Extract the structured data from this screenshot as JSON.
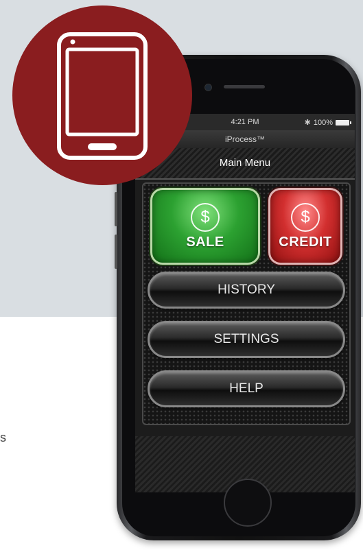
{
  "background": {
    "top_color": "#d9dee2",
    "bottom_color": "#ffffff",
    "stray_text": "s"
  },
  "badge": {
    "color": "#8a1d1f",
    "icon": "tablet-icon"
  },
  "statusbar": {
    "time": "4:21 PM",
    "battery": "100%",
    "bluetooth_icon": "bluetooth-icon"
  },
  "app": {
    "title": "iProcess™",
    "menu_title": "Main Menu"
  },
  "buttons": {
    "sale": {
      "label": "SALE",
      "symbol": "$",
      "color": "#2ca131"
    },
    "credit": {
      "label": "CREDIT",
      "symbol": "$",
      "color": "#d22f2f"
    },
    "history": {
      "label": "HISTORY"
    },
    "settings": {
      "label": "SETTINGS"
    },
    "help": {
      "label": "HELP"
    }
  }
}
